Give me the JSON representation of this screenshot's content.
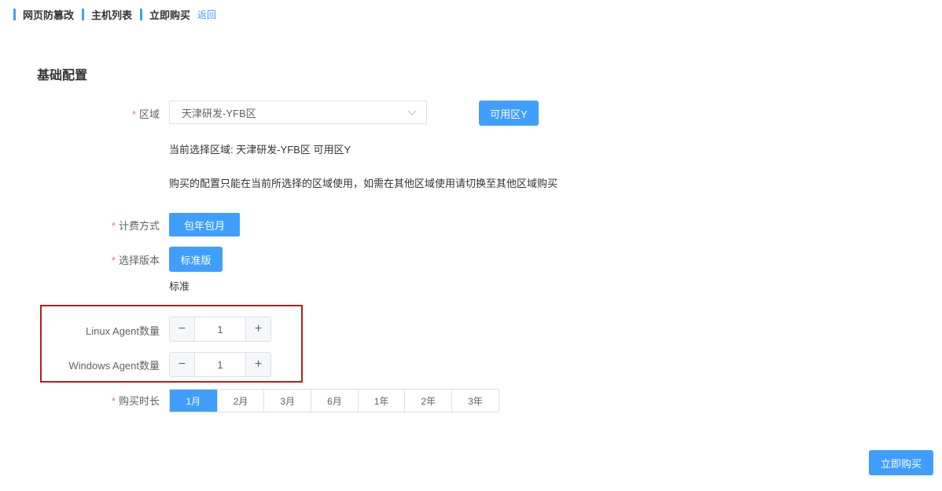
{
  "breadcrumb": {
    "items": [
      "网页防篡改",
      "主机列表",
      "立即购买"
    ],
    "back_label": "返回"
  },
  "section": {
    "title": "基础配置"
  },
  "region": {
    "required_mark": "*",
    "label": "区域",
    "selected": "天津研发-YFB区",
    "zone_button": "可用区Y",
    "current_selection": "当前选择区域:   天津研发-YFB区 可用区Y",
    "note": "购买的配置只能在当前所选择的区域使用，如需在其他区域使用请切换至其他区域购买"
  },
  "billing": {
    "required_mark": "*",
    "label": "计费方式",
    "option": "包年包月"
  },
  "edition": {
    "required_mark": "*",
    "label": "选择版本",
    "option": "标准版",
    "description": "标准"
  },
  "agents": {
    "linux": {
      "label": "Linux Agent数量",
      "value": "1",
      "minus": "−",
      "plus": "+"
    },
    "windows": {
      "label": "Windows Agent数量",
      "value": "1",
      "minus": "−",
      "plus": "+"
    }
  },
  "duration": {
    "required_mark": "*",
    "label": "购买时长",
    "options": [
      "1月",
      "2月",
      "3月",
      "6月",
      "1年",
      "2年",
      "3年"
    ],
    "selected_index": 0
  },
  "actions": {
    "buy_now": "立即购买"
  },
  "colors": {
    "accent": "#409eff",
    "required": "#f56c6c",
    "highlight_border": "#b71c1c"
  }
}
